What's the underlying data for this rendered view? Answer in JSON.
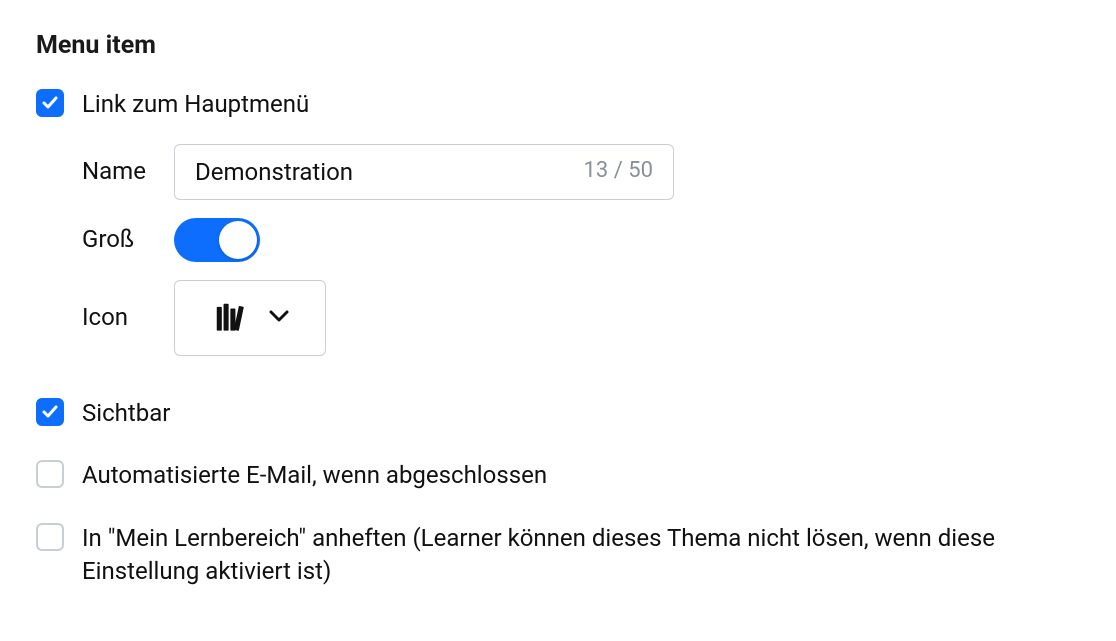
{
  "section_heading": "Menu item",
  "link_main_menu": {
    "checked": true,
    "label": "Link zum Hauptmenü"
  },
  "name_field": {
    "label": "Name",
    "value": "Demonstration",
    "counter": "13 / 50"
  },
  "large_toggle": {
    "label": "Groß",
    "on": true
  },
  "icon_field": {
    "label": "Icon",
    "selected": "books-icon"
  },
  "visible": {
    "checked": true,
    "label": "Sichtbar"
  },
  "auto_email": {
    "checked": false,
    "label": "Automatisierte E-Mail, wenn abgeschlossen"
  },
  "pin_learning": {
    "checked": false,
    "label": "In \"Mein Lernbereich\" anheften (Learner können dieses Thema nicht lösen, wenn diese Einstellung aktiviert ist)"
  }
}
